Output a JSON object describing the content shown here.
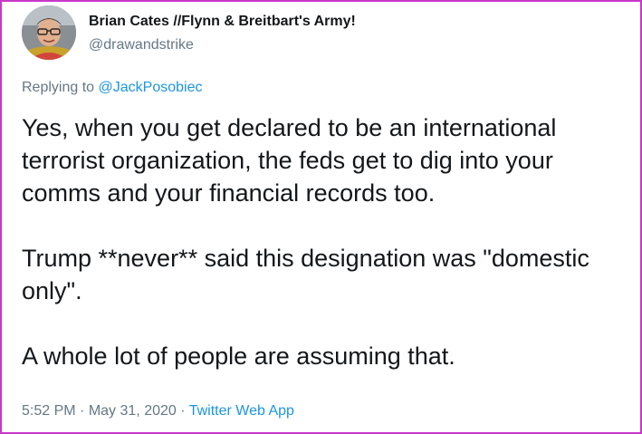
{
  "author": {
    "display_name": "Brian Cates //Flynn & Breitbart's Army!",
    "handle": "@drawandstrike"
  },
  "reply": {
    "prefix": "Replying to",
    "mention": "@JackPosobiec"
  },
  "tweet": {
    "paragraphs": [
      "Yes, when you get declared to be an international terrorist organization, the feds get to dig into your comms and your financial records too.",
      "Trump **never** said this designation was \"domestic only\".",
      "A whole lot of people are assuming that."
    ]
  },
  "meta": {
    "time": "5:52 PM",
    "separator": "·",
    "date": "May 31, 2020",
    "app": "Twitter Web App"
  },
  "colors": {
    "frame_border": "#c838c8",
    "link": "#1b95e0",
    "secondary_text": "#657786",
    "primary_text": "#14171a"
  }
}
